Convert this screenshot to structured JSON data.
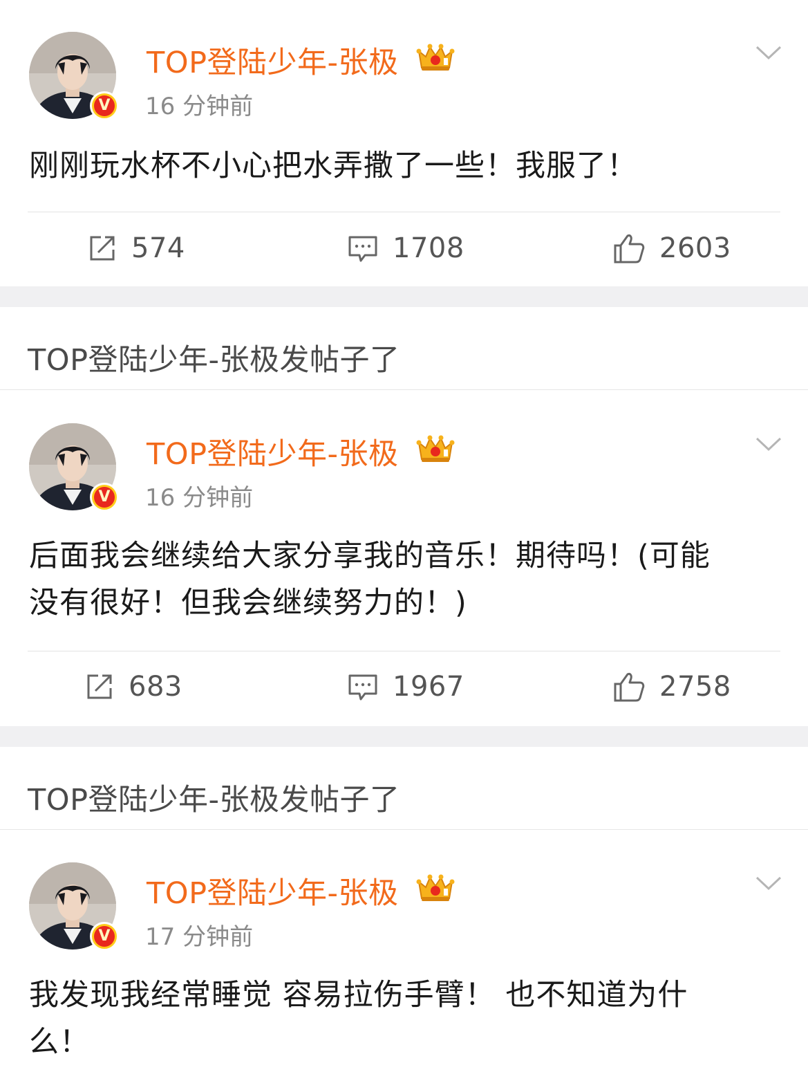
{
  "colors": {
    "username": "#f26a1b",
    "verified_badge": "#ffcc1a",
    "verified_badge_inner": "#e8281e",
    "separator_background": "#f0f0f2"
  },
  "repost_banner": "TOP登陆少年-张极发帖子了",
  "posts": [
    {
      "username": "TOP登陆少年-张极",
      "verified_icon": "v-badge-icon",
      "crown_icon": "crown-icon",
      "timestamp": "16 分钟前",
      "text": "刚刚玩水杯不小心把水弄撒了一些！我服了！",
      "reposts": "574",
      "comments": "1708",
      "likes": "2603"
    },
    {
      "username": "TOP登陆少年-张极",
      "verified_icon": "v-badge-icon",
      "crown_icon": "crown-icon",
      "timestamp": "16 分钟前",
      "text_line1": "后面我会继续给大家分享我的音乐！期待吗！(可能",
      "text_line2": "没有很好！但我会继续努力的！)",
      "reposts": "683",
      "comments": "1967",
      "likes": "2758"
    },
    {
      "username": "TOP登陆少年-张极",
      "verified_icon": "v-badge-icon",
      "crown_icon": "crown-icon",
      "timestamp": "17 分钟前",
      "text_line1": "我发现我经常睡觉 容易拉伤手臂！ 也不知道为什",
      "text_line2": "么！"
    }
  ],
  "badge_letter": "V"
}
